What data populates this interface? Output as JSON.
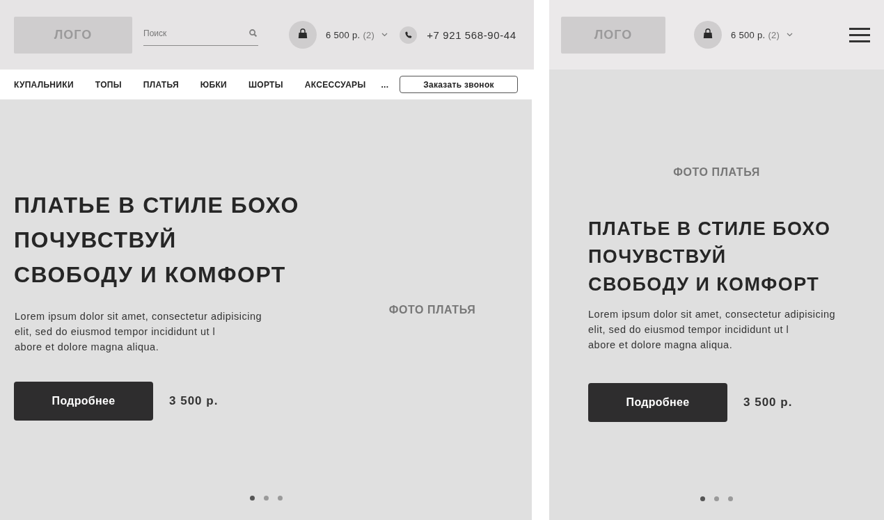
{
  "desktop": {
    "header": {
      "logo": "ЛОГО",
      "search": {
        "placeholder": "Поиск"
      },
      "cart": {
        "total": "6 500 р.",
        "count": "(2)"
      },
      "phone": "+7 921 568-90-44"
    },
    "nav": {
      "items": [
        "КУПАЛЬНИКИ",
        "ТОПЫ",
        "ПЛАТЬЯ",
        "ЮБКИ",
        "ШОРТЫ",
        "АКСЕССУАРЫ"
      ],
      "more": "...",
      "callback_button": "Заказать звонок"
    },
    "hero": {
      "title": "ПЛАТЬЕ В СТИЛЕ БОХО\nПОЧУВСТВУЙ\nСВОБОДУ И КОМФОРТ",
      "text": "Lorem ipsum dolor sit amet, consectetur adipisicing\nelit, sed do eiusmod tempor incididunt ut l\nabore et dolore magna aliqua.",
      "button": "Подробнее",
      "price": "3 500 р.",
      "photo_label": "ФОТО ПЛАТЬЯ",
      "dots": [
        {
          "selected": true
        },
        {
          "selected": false
        },
        {
          "selected": false
        }
      ]
    }
  },
  "mobile": {
    "header": {
      "logo": "ЛОГО",
      "cart": {
        "total": "6 500 р.",
        "count": "(2)"
      }
    },
    "hero": {
      "photo_label": "ФОТО ПЛАТЬЯ",
      "title": "ПЛАТЬЕ В СТИЛЕ БОХО\nПОЧУВСТВУЙ\nСВОБОДУ И КОМФОРТ",
      "text": "Lorem ipsum dolor sit amet, consectetur adipisicing\nelit, sed do eiusmod tempor incididunt ut l\nabore et dolore magna aliqua.",
      "button": "Подробнее",
      "price": "3 500 р.",
      "dots": [
        {
          "selected": true
        },
        {
          "selected": false
        },
        {
          "selected": false
        }
      ]
    }
  }
}
